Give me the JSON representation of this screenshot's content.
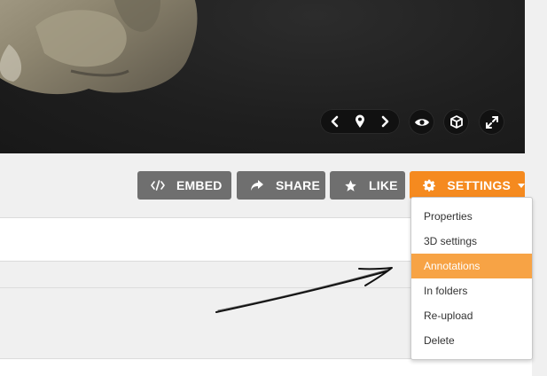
{
  "viewer": {
    "controls": {
      "prev_icon": "chevron-left-icon",
      "location_icon": "map-pin-icon",
      "next_icon": "chevron-right-icon",
      "view_icon": "eye-icon",
      "model_icon": "cube-icon",
      "fullscreen_icon": "expand-icon"
    }
  },
  "toolbar": {
    "embed_label": "EMBED",
    "share_label": "SHARE",
    "like_label": "LIKE",
    "settings_label": "SETTINGS"
  },
  "settings_menu": {
    "items": [
      {
        "label": "Properties",
        "active": false
      },
      {
        "label": "3D settings",
        "active": false
      },
      {
        "label": "Annotations",
        "active": true
      },
      {
        "label": "In folders",
        "active": false
      },
      {
        "label": "Re-upload",
        "active": false
      },
      {
        "label": "Delete",
        "active": false
      }
    ]
  },
  "colors": {
    "accent": "#f58a1f",
    "active_item": "#f7a345",
    "button_grey": "#6f6f6f",
    "viewer_bg": "#1f1f1f"
  }
}
